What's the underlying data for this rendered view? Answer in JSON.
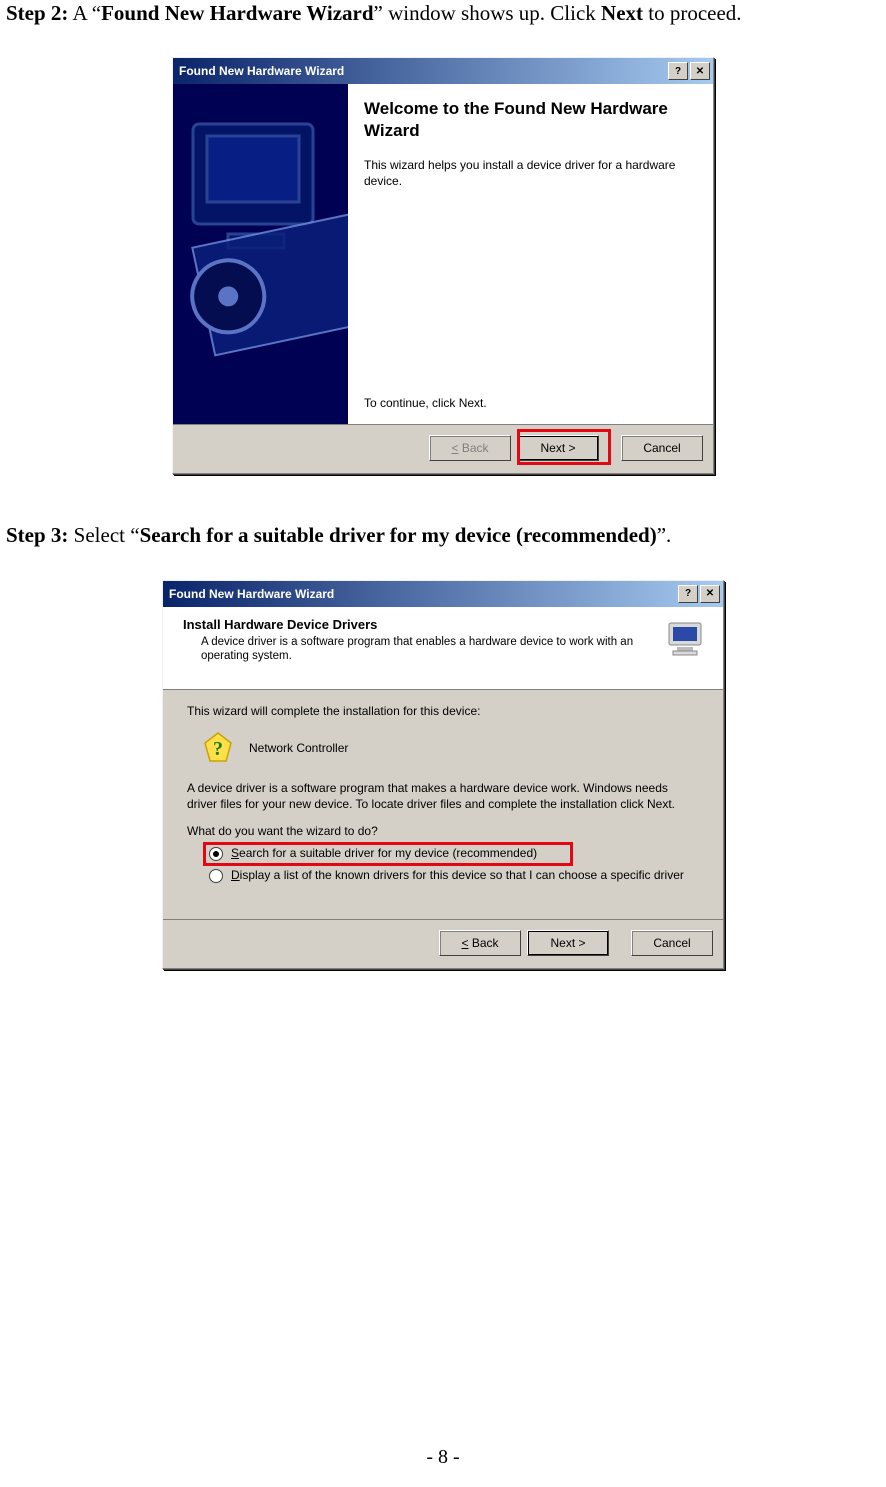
{
  "step2": {
    "label": "Step 2:",
    "pre": " A “",
    "emph": "Found New Hardware Wizard",
    "mid": "” window shows up. Click ",
    "action": "Next",
    "post": " to proceed."
  },
  "step3": {
    "label": "Step 3:",
    "pre": " Select “",
    "emph": "Search for a suitable driver for my device (recommended)",
    "post": "”."
  },
  "wizard1": {
    "title": "Found New Hardware Wizard",
    "welcome_title": "Welcome to the Found New Hardware Wizard",
    "intro": "This wizard helps you install a device driver for a hardware device.",
    "continue": "To continue, click Next.",
    "back": "< Back",
    "next": "Next >",
    "cancel": "Cancel"
  },
  "wizard2": {
    "title": "Found New Hardware Wizard",
    "head_title": "Install Hardware Device Drivers",
    "head_sub": "A device driver is a software program that enables a hardware device to work with an operating system.",
    "line1": "This wizard will complete the installation for this device:",
    "device": "Network Controller",
    "line2": "A device driver is a software program that makes a hardware device work. Windows needs driver files for your new device. To locate driver files and complete the installation click Next.",
    "question": "What do you want the wizard to do?",
    "opt1": "Search for a suitable driver for my device (recommended)",
    "opt2": "Display a list of the known drivers for this device so that I can choose a specific driver",
    "back": "< Back",
    "next": "Next >",
    "cancel": "Cancel"
  },
  "page_number": "- 8 -"
}
